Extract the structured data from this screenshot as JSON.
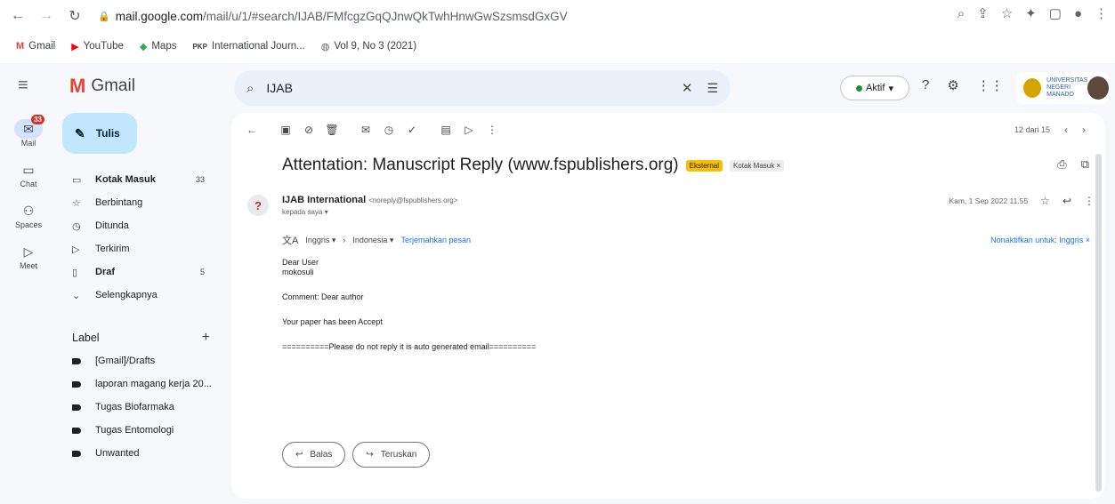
{
  "browser": {
    "url_host": "mail.google.com",
    "url_path": "/mail/u/1/#search/IJAB/FMfcgzGqQJnwQkTwhHnwGwSzsmsdGxGV",
    "bookmarks": [
      {
        "icon": "gmail-icon",
        "label": "Gmail"
      },
      {
        "icon": "youtube-icon",
        "label": "YouTube"
      },
      {
        "icon": "maps-icon",
        "label": "Maps"
      },
      {
        "icon": "journal-icon",
        "label": "International Journ..."
      },
      {
        "icon": "globe-icon",
        "label": "Vol 9, No 3 (2021)"
      }
    ]
  },
  "gmail": {
    "product": "Gmail",
    "search_value": "IJAB",
    "status": "Aktif",
    "org_text": "UNIVERSITAS NEGERI MANADO"
  },
  "rail": [
    {
      "label": "Mail",
      "icon": "mail-icon",
      "badge": "33",
      "active": true
    },
    {
      "label": "Chat",
      "icon": "chat-icon"
    },
    {
      "label": "Spaces",
      "icon": "spaces-icon"
    },
    {
      "label": "Meet",
      "icon": "meet-icon"
    }
  ],
  "sidebar": {
    "compose": "Tulis",
    "items": [
      {
        "label": "Kotak Masuk",
        "count": "33",
        "bold": true,
        "icon": "inbox-icon"
      },
      {
        "label": "Berbintang",
        "count": "",
        "icon": "star-icon"
      },
      {
        "label": "Ditunda",
        "count": "",
        "icon": "clock-icon"
      },
      {
        "label": "Terkirim",
        "count": "",
        "icon": "send-icon"
      },
      {
        "label": "Draf",
        "count": "5",
        "bold": true,
        "icon": "draft-icon"
      },
      {
        "label": "Selengkapnya",
        "count": "",
        "icon": "chevron-down-icon"
      }
    ],
    "label_heading": "Label",
    "labels": [
      "[Gmail]/Drafts",
      "laporan magang kerja 20...",
      "Tugas Biofarmaka",
      "Tugas Entomologi",
      "Unwanted"
    ]
  },
  "email": {
    "pager": "12 dari 15",
    "subject": "Attentation: Manuscript Reply (www.fspublishers.org)",
    "chip_external": "Eksternal",
    "chip_inbox": "Kotak Masuk ×",
    "sender_name": "IJAB International",
    "sender_email": "<noreply@fspublishers.org>",
    "to_line": "kepada saya ▾",
    "date": "Kam, 1 Sep 2022 11.55",
    "translate": {
      "from": "Inggris ▾",
      "to": "Indonesia ▾",
      "action": "Terjemahkan pesan",
      "disable": "Nonaktifkan untuk: Inggris ×"
    },
    "body": {
      "greeting": "Dear User",
      "name": "mokosuli",
      "comment": "Comment: Dear author",
      "status": "Your paper has been Accept",
      "footer": "==========Please do not reply it is auto generated email=========="
    },
    "reply_label": "Balas",
    "forward_label": "Teruskan"
  }
}
